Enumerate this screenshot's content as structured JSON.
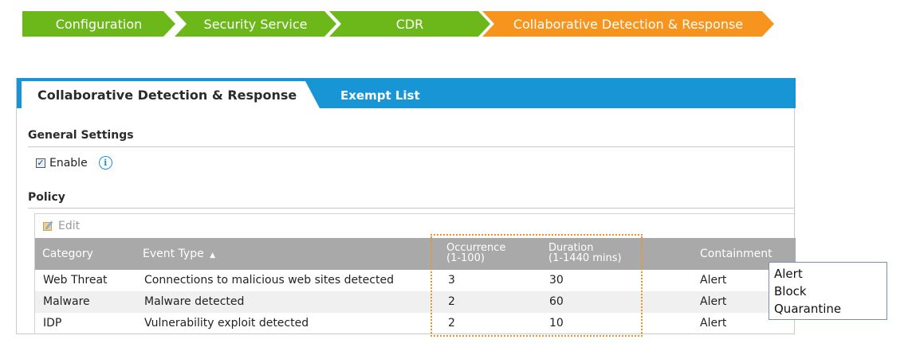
{
  "breadcrumb": [
    {
      "label": "Configuration",
      "color": "#6cb81b"
    },
    {
      "label": "Security Service",
      "color": "#6cb81b"
    },
    {
      "label": "CDR",
      "color": "#6cb81b"
    },
    {
      "label": "Collaborative Detection & Response",
      "color": "#f7941d"
    }
  ],
  "tabs": {
    "active": "Collaborative Detection & Response",
    "inactive": "Exempt List"
  },
  "general": {
    "title": "General Settings",
    "enable_label": "Enable",
    "enable_checked": true
  },
  "policy": {
    "title": "Policy",
    "edit_label": "Edit",
    "columns": {
      "category": "Category",
      "event_type": "Event Type",
      "sort_indicator": "▲",
      "occurrence": "Occurrence",
      "occurrence_range": "(1-100)",
      "duration": "Duration",
      "duration_range": "(1-1440 mins)",
      "containment": "Containment"
    },
    "rows": [
      {
        "category": "Web Threat",
        "event_type": "Connections to malicious web sites detected",
        "occurrence": "3",
        "duration": "30",
        "containment": "Alert"
      },
      {
        "category": "Malware",
        "event_type": "Malware detected",
        "occurrence": "2",
        "duration": "60",
        "containment": "Alert"
      },
      {
        "category": "IDP",
        "event_type": "Vulnerability exploit detected",
        "occurrence": "2",
        "duration": "10",
        "containment": "Alert"
      }
    ]
  },
  "containment_dropdown": {
    "options": [
      "Alert",
      "Block",
      "Quarantine"
    ]
  },
  "colors": {
    "tab_bar": "#1795d4",
    "breadcrumb_green": "#6cb81b",
    "breadcrumb_orange": "#f7941d",
    "highlight_border": "#f29222",
    "table_header": "#a9a9a9"
  }
}
